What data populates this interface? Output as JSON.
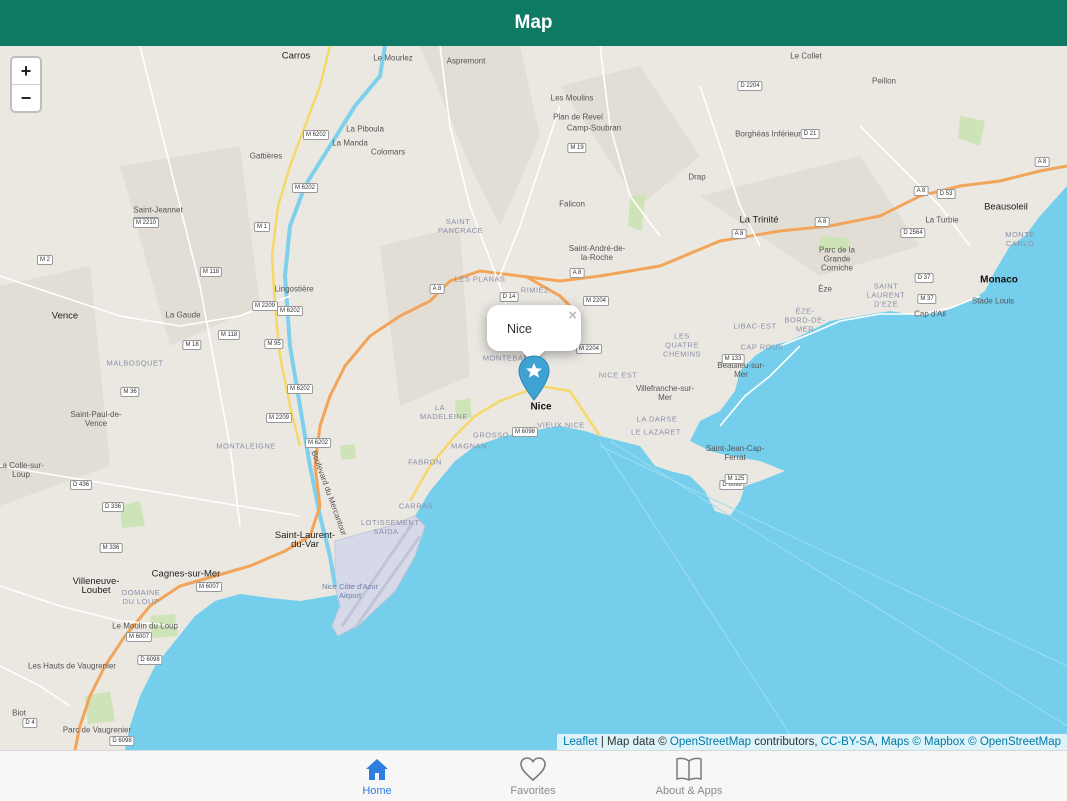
{
  "header": {
    "title": "Map"
  },
  "map": {
    "zoom_in": "+",
    "zoom_out": "−",
    "popup": {
      "text": "Nice",
      "close": "×"
    },
    "places": [
      {
        "text": "Carros",
        "cls": "city"
      },
      {
        "text": "Aspremont",
        "cls": ""
      },
      {
        "text": "Le Mourlez",
        "cls": ""
      },
      {
        "text": "Le Collet",
        "cls": ""
      },
      {
        "text": "Peillon",
        "cls": ""
      },
      {
        "text": "Les Moulins",
        "cls": ""
      },
      {
        "text": "Plan de Revel",
        "cls": ""
      },
      {
        "text": "Camp-Soubran",
        "cls": ""
      },
      {
        "text": "La Piboula",
        "cls": ""
      },
      {
        "text": "La Manda",
        "cls": ""
      },
      {
        "text": "Colomars",
        "cls": ""
      },
      {
        "text": "Gattières",
        "cls": ""
      },
      {
        "text": "Borghéas Inférieur",
        "cls": ""
      },
      {
        "text": "Drap",
        "cls": ""
      },
      {
        "text": "Saint-Jeannet",
        "cls": ""
      },
      {
        "text": "Falicon",
        "cls": ""
      },
      {
        "text": "La Trinité",
        "cls": "city"
      },
      {
        "text": "Beausoleil",
        "cls": "city"
      },
      {
        "text": "La Turbie",
        "cls": ""
      },
      {
        "text": "SAINT PANCRACE",
        "cls": "district"
      },
      {
        "text": "Saint-André-de-la-Roche",
        "cls": ""
      },
      {
        "text": "Parc de la Grande Corniche",
        "cls": ""
      },
      {
        "text": "MONTE CARLO",
        "cls": "district"
      },
      {
        "text": "Monaco",
        "cls": "big"
      },
      {
        "text": "Lingostière",
        "cls": ""
      },
      {
        "text": "LES PLANAS",
        "cls": "district"
      },
      {
        "text": "RIMIEZ",
        "cls": "district"
      },
      {
        "text": "Èze",
        "cls": ""
      },
      {
        "text": "SAINT LAURENT D'EZE",
        "cls": "district"
      },
      {
        "text": "Stade Louis",
        "cls": ""
      },
      {
        "text": "Vence",
        "cls": "city"
      },
      {
        "text": "La Gaude",
        "cls": ""
      },
      {
        "text": "Cap d'Ail",
        "cls": ""
      },
      {
        "text": "ÈZE-BORD-DE-MER",
        "cls": "district"
      },
      {
        "text": "LIBAC-EST",
        "cls": "district"
      },
      {
        "text": "LES QUATRE CHEMINS",
        "cls": "district"
      },
      {
        "text": "CAP ROUX",
        "cls": "district"
      },
      {
        "text": "MONTEBAN",
        "cls": "district"
      },
      {
        "text": "MALBOSQUET",
        "cls": "district"
      },
      {
        "text": "Beaulieu-sur-Mer",
        "cls": ""
      },
      {
        "text": "NICE EST",
        "cls": "district"
      },
      {
        "text": "Villefranche-sur-Mer",
        "cls": ""
      },
      {
        "text": "Nice",
        "cls": "big"
      },
      {
        "text": "Saint-Paul-de-Vence",
        "cls": ""
      },
      {
        "text": "LA MADELEINE",
        "cls": "district"
      },
      {
        "text": "VIEUX NICE",
        "cls": "district"
      },
      {
        "text": "LA DARSE",
        "cls": "district"
      },
      {
        "text": "LE LAZARET",
        "cls": "district"
      },
      {
        "text": "MONTALEIGNE",
        "cls": "district"
      },
      {
        "text": "GROSSO",
        "cls": "district"
      },
      {
        "text": "MAGNAN",
        "cls": "district"
      },
      {
        "text": "Saint-Jean-Cap-Ferrat",
        "cls": ""
      },
      {
        "text": "La Colle-sur-Loup",
        "cls": ""
      },
      {
        "text": "FABRON",
        "cls": "district"
      },
      {
        "text": "Boulevard du Mercantour",
        "cls": ""
      },
      {
        "text": "CARRAS",
        "cls": "district"
      },
      {
        "text": "LOTISSEMENT SAIDA",
        "cls": "district"
      },
      {
        "text": "Saint-Laurent-du-Var",
        "cls": "city"
      },
      {
        "text": "Cagnes-sur-Mer",
        "cls": "city"
      },
      {
        "text": "Villeneuve-Loubet",
        "cls": "city"
      },
      {
        "text": "DOMAINE DU LOUP",
        "cls": "district"
      },
      {
        "text": "Nice Côte d'Azur Airport",
        "cls": "water"
      },
      {
        "text": "Le Moulin du Loup",
        "cls": ""
      },
      {
        "text": "Les Hauts de Vaugrenier",
        "cls": ""
      },
      {
        "text": "Biot",
        "cls": ""
      },
      {
        "text": "Parc de Vaugrenier",
        "cls": ""
      }
    ],
    "roads": [
      "M 6202",
      "M 2210",
      "M 6202",
      "M 1",
      "M 2210",
      "M 2",
      "M 118",
      "M 2209",
      "M 6202",
      "M 118",
      "M 95",
      "M 6202",
      "M 2209",
      "M 6202",
      "M 36",
      "M 18",
      "M 6098",
      "M 336",
      "M 6007",
      "M 6007",
      "D 6098",
      "D 436",
      "D 336",
      "D 4",
      "D 6098",
      "A 8",
      "A 8",
      "A 8",
      "D 14",
      "M 2204",
      "M 2204",
      "M 19",
      "D 2204",
      "D 21",
      "D 53",
      "A 8",
      "A 8",
      "D 2564",
      "D 37",
      "M 37",
      "D 6098",
      "M 125",
      "M 133",
      "A 8"
    ]
  },
  "attribution": {
    "leaflet": "Leaflet",
    "mapdata": " | Map data © ",
    "osm": "OpenStreetMap",
    "contrib": " contributors, ",
    "ccbysa": "CC-BY-SA",
    "comma": ", ",
    "maps_mapbox": "Maps © Mapbox",
    "sep": " © ",
    "osm2": "OpenStreetMap"
  },
  "tabs": [
    {
      "label": "Home",
      "icon": "house-icon",
      "active": true
    },
    {
      "label": "Favorites",
      "icon": "heart-icon",
      "active": false
    },
    {
      "label": "About & Apps",
      "icon": "book-icon",
      "active": false
    }
  ]
}
